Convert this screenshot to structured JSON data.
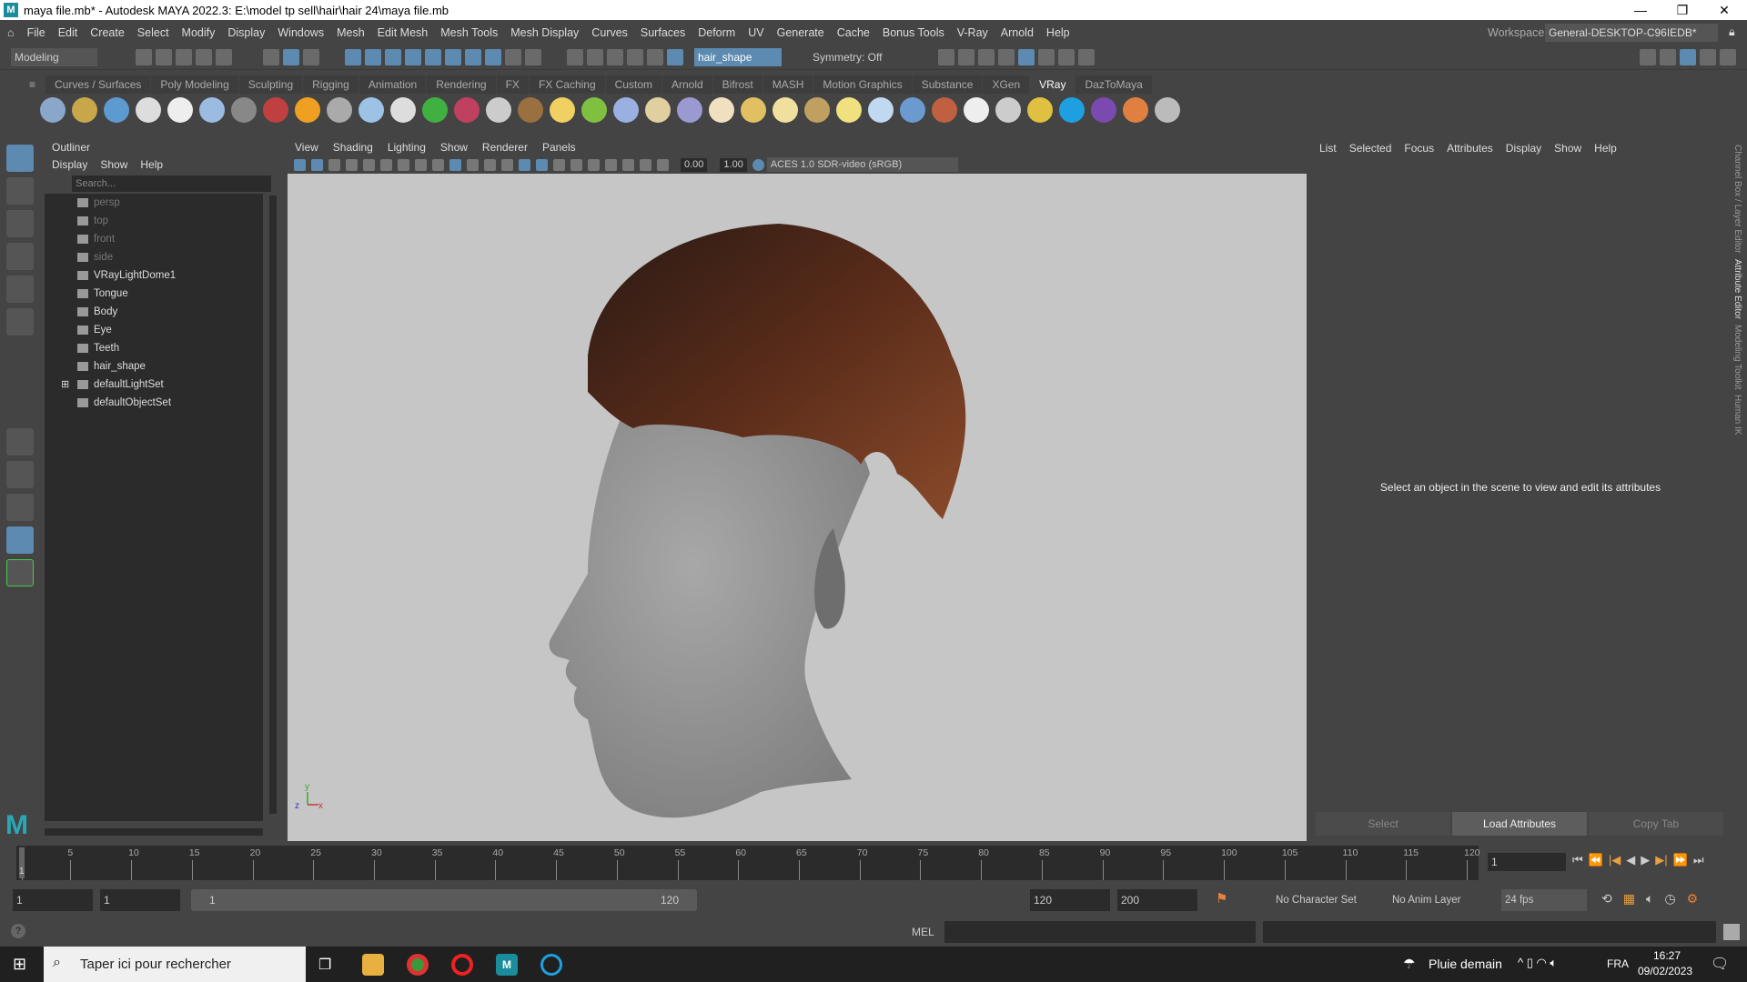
{
  "window": {
    "title": "maya file.mb* - Autodesk MAYA 2022.3: E:\\model tp sell\\hair\\hair 24\\maya file.mb",
    "logo": "M",
    "minimize": "—",
    "maximize": "❐",
    "close": "✕"
  },
  "menubar": {
    "items": [
      "File",
      "Edit",
      "Create",
      "Select",
      "Modify",
      "Display",
      "Windows",
      "Mesh",
      "Edit Mesh",
      "Mesh Tools",
      "Mesh Display",
      "Curves",
      "Surfaces",
      "Deform",
      "UV",
      "Generate",
      "Cache",
      "Bonus Tools",
      "V-Ray",
      "Arnold",
      "Help"
    ],
    "workspace_label": "Workspace:",
    "workspace_value": "General-DESKTOP-C96IEDB*"
  },
  "toolbar": {
    "mode": "Modeling",
    "object_field": "hair_shape",
    "symmetry": "Symmetry: Off"
  },
  "shelf": {
    "tabs": [
      "Curves / Surfaces",
      "Poly Modeling",
      "Sculpting",
      "Rigging",
      "Animation",
      "Rendering",
      "FX",
      "FX Caching",
      "Custom",
      "Arnold",
      "Bifrost",
      "MASH",
      "Motion Graphics",
      "Substance",
      "XGen",
      "VRay",
      "DazToMaya"
    ],
    "active": "VRay",
    "icon_colors": [
      "#8aa6c9",
      "#c8a64a",
      "#5c9ad0",
      "#ddd",
      "#eee",
      "#9bbbe0",
      "#888",
      "#c04040",
      "#f0a020",
      "#aaa",
      "#9cc3e6",
      "#ddd",
      "#40b040",
      "#c04060",
      "#ccc",
      "#9a7040",
      "#f0d060",
      "#80c040",
      "#9ab0e0",
      "#e0d0a0",
      "#9a9ad0",
      "#f0e0c0",
      "#e0c060",
      "#f0e0a0",
      "#c0a060",
      "#f0e080",
      "#c0d8f0",
      "#6a9ad0",
      "#c06040",
      "#eee",
      "#ccc",
      "#e0c040",
      "#1ea0e0",
      "#7a4ab0",
      "#e08040",
      "#bbb"
    ]
  },
  "outliner": {
    "title": "Outliner",
    "menu": [
      "Display",
      "Show",
      "Help"
    ],
    "search_placeholder": "Search...",
    "items": [
      {
        "label": "persp",
        "dim": true
      },
      {
        "label": "top",
        "dim": true
      },
      {
        "label": "front",
        "dim": true
      },
      {
        "label": "side",
        "dim": true
      },
      {
        "label": "VRayLightDome1"
      },
      {
        "label": "Tongue"
      },
      {
        "label": "Body"
      },
      {
        "label": "Eye"
      },
      {
        "label": "Teeth"
      },
      {
        "label": "hair_shape"
      },
      {
        "label": "defaultLightSet",
        "expand": "⊞"
      },
      {
        "label": "defaultObjectSet"
      }
    ]
  },
  "viewport": {
    "menu": [
      "View",
      "Shading",
      "Lighting",
      "Show",
      "Renderer",
      "Panels"
    ],
    "exposure": "0.00",
    "gamma": "1.00",
    "colorspace": "ACES 1.0 SDR-video (sRGB)",
    "axis_labels": {
      "y": "y",
      "z": "z",
      "x": "x"
    }
  },
  "attribute_editor": {
    "menu": [
      "List",
      "Selected",
      "Focus",
      "Attributes",
      "Display",
      "Show",
      "Help"
    ],
    "message": "Select an object in the scene to view and edit its attributes",
    "buttons": [
      "Select",
      "Load Attributes",
      "Copy Tab"
    ],
    "side_tabs": [
      "Channel Box / Layer Editor",
      "Attribute Editor",
      "Modeling Toolkit",
      "Human IK"
    ]
  },
  "timeline": {
    "start": 1,
    "end": 120,
    "label_step": 5,
    "current_frame": "1",
    "current_marker": "1"
  },
  "range": {
    "start": "1",
    "playback_start": "1",
    "slider_start": "1",
    "slider_end": "120",
    "playback_end": "120",
    "end": "200",
    "character_set": "No Character Set",
    "anim_layer": "No Anim Layer",
    "fps": "24 fps"
  },
  "command": {
    "language": "MEL",
    "help": "?"
  },
  "taskbar": {
    "search_placeholder": "Taper ici pour rechercher",
    "weather": "Pluie demain",
    "lang": "FRA",
    "time": "16:27",
    "date": "09/02/2023"
  }
}
